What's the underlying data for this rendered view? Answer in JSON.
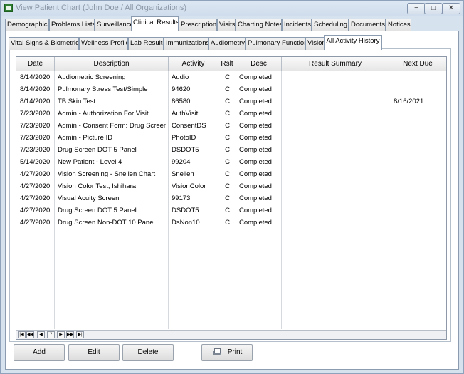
{
  "window": {
    "title": "View Patient Chart (John Doe / All Organizations)",
    "controls": [
      "−",
      "□",
      "✕"
    ]
  },
  "main_tabs": [
    {
      "label": "Demographics"
    },
    {
      "label": "Problems Lists"
    },
    {
      "label": "Surveillance"
    },
    {
      "label": "Clinical Results",
      "active": true
    },
    {
      "label": "Prescriptions"
    },
    {
      "label": "Visits"
    },
    {
      "label": "Charting Notes"
    },
    {
      "label": "Incidents"
    },
    {
      "label": "Scheduling"
    },
    {
      "label": "Documents"
    },
    {
      "label": "Notices"
    }
  ],
  "sub_tabs": [
    {
      "label": "Vital Signs & Biometrics"
    },
    {
      "label": "Wellness Profile"
    },
    {
      "label": "Lab Results"
    },
    {
      "label": "Immunizations"
    },
    {
      "label": "Audiometry"
    },
    {
      "label": "Pulmonary Function"
    },
    {
      "label": "Vision"
    },
    {
      "label": "All Activity History",
      "active": true
    }
  ],
  "grid": {
    "columns": [
      "Date",
      "Description",
      "Activity",
      "Rslt",
      "Desc",
      "Result Summary",
      "Next Due"
    ],
    "rows": [
      [
        "8/14/2020",
        "Audiometric Screening",
        "Audio",
        "C",
        "Completed",
        "",
        ""
      ],
      [
        "8/14/2020",
        "Pulmonary Stress Test/Simple",
        "94620",
        "C",
        "Completed",
        "",
        ""
      ],
      [
        "8/14/2020",
        "TB Skin Test",
        "86580",
        "C",
        "Completed",
        "",
        "8/16/2021"
      ],
      [
        "7/23/2020",
        "Admin - Authorization For Visit",
        "AuthVisit",
        "C",
        "Completed",
        "",
        ""
      ],
      [
        "7/23/2020",
        "Admin - Consent Form: Drug Screen",
        "ConsentDS",
        "C",
        "Completed",
        "",
        ""
      ],
      [
        "7/23/2020",
        "Admin - Picture ID",
        "PhotoID",
        "C",
        "Completed",
        "",
        ""
      ],
      [
        "7/23/2020",
        "Drug Screen DOT 5 Panel",
        "DSDOT5",
        "C",
        "Completed",
        "",
        ""
      ],
      [
        "5/14/2020",
        "New Patient - Level 4",
        "99204",
        "C",
        "Completed",
        "",
        ""
      ],
      [
        "4/27/2020",
        "Vision Screening - Snellen Chart",
        "Snellen",
        "C",
        "Completed",
        "",
        ""
      ],
      [
        "4/27/2020",
        "Vision Color Test, Ishihara",
        "VisionColor",
        "C",
        "Completed",
        "",
        ""
      ],
      [
        "4/27/2020",
        "Visual Acuity Screen",
        "99173",
        "C",
        "Completed",
        "",
        ""
      ],
      [
        "4/27/2020",
        "Drug Screen DOT 5 Panel",
        "DSDOT5",
        "C",
        "Completed",
        "",
        ""
      ],
      [
        "4/27/2020",
        "Drug Screen Non-DOT 10 Panel",
        "DsNon10",
        "C",
        "Completed",
        "",
        ""
      ]
    ],
    "nav_buttons": [
      "first-icon",
      "prev-page-icon",
      "prev-icon",
      "help-icon",
      "next-icon",
      "next-page-icon",
      "last-icon"
    ],
    "nav_glyphs": [
      "|◀",
      "◀◀",
      "◀",
      "?",
      "▶",
      "▶▶",
      "▶|"
    ]
  },
  "buttons": {
    "add": "Add",
    "edit": "Edit",
    "delete": "Delete",
    "print": "Print"
  }
}
